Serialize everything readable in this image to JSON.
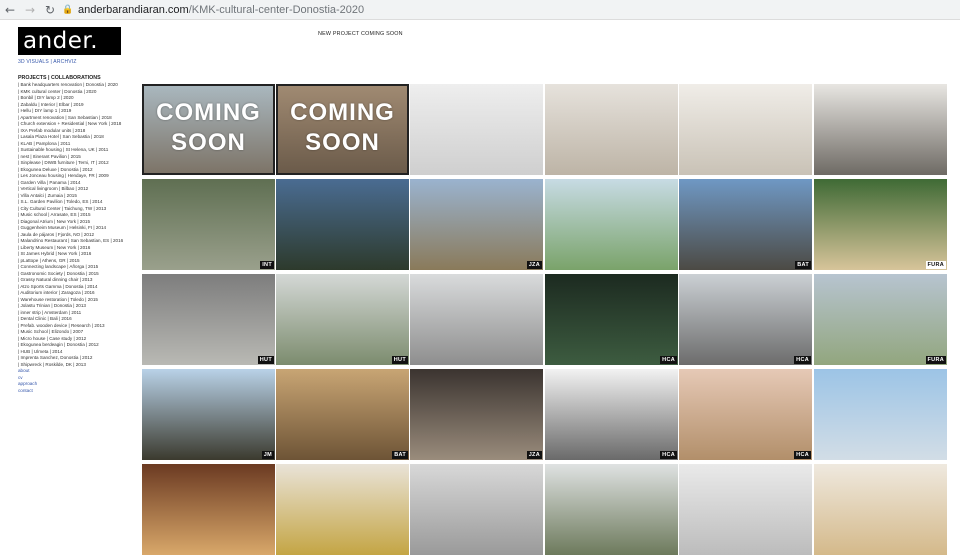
{
  "browser": {
    "back_icon": "arrow-left-icon",
    "forward_icon": "arrow-right-icon",
    "reload_icon": "reload-icon",
    "lock_icon": "lock-icon",
    "url_domain": "anderbarandiaran.com",
    "url_path": "/KMK-cultural-center-Donostia-2020"
  },
  "logo": "ander.",
  "subtitle": "3D VISUALS | ARCHVIZ",
  "notice": "NEW PROJECT COMING SOON",
  "projects_heading": "PROJECTS | COLLABORATIONS",
  "projects": [
    "| Bank headquarters renovation | Donostia | 2020",
    "| KMK cultural center | Donostia | 2020",
    "| Bonbil | DIY lamp 2 | 2020",
    "| Zabaldu | Interior | Elbar | 2019",
    "| Hellu | DIY lamp 1 | 2019",
    "| Apartment renovation | San Sebastian | 2018",
    "| Church extension + Residential | New York | 2018",
    "| IXA Prefab modular units | 2018",
    "| Lasala Plaza Hotel | San Sebastia | 2018",
    "| KLAB | Pamplona | 2011",
    "| Sustainable housing | St Helena, UK | 2011",
    "| nest | Itinerant Pavilion | 2015",
    "| Sinplease | DIWB furniture | Terni, IT | 2012",
    "| Ekogunea Deluxe | Donostia | 2012",
    "| Les Jonceau housing | Hendaye, FR | 2009",
    "| Garden Villa | Panama | 2014",
    "| Vertical livingroom | Bilbao | 2012",
    "| Villa Antalci | Zumaia | 2015",
    "| S.L. Garden Pavilion | Toledo, ES | 2014",
    "| City Cultural Center | Taichung, TW | 2013",
    "| Music school | Arrasate, ES | 2015",
    "| Diagonal Atrium | New York | 2015",
    "| Guggenheim Museum | Helsinki, FI | 2014",
    "| Jaula de pájaros | Fjords, NO | 2012",
    "| Malandrino Restaurant | San Sebastian, ES | 2016",
    "| Liberty Museum | New York | 2016",
    "| St James Hybrid | New York | 2016",
    "| pLattope | Athens, GR | 2015",
    "| Connecting landscape | Añorga | 2015",
    "| Gastronomic Society | Donostia | 2015",
    "| Grassy Natural dinning chair | 2013",
    "| Atzo Sports Gamma | Donostia | 2014",
    "| Auditorium interior | Zaragoza | 2016",
    "| Warehouse restoration | Toledo | 2015",
    "| Jolastu Trinian | Donostia | 2013",
    "| inner strip | Amsterdam | 2011",
    "| Dental Clinic | Bali | 2016",
    "| Prefab. wooden device | Research | 2013",
    "| Music School | Elizondo | 2007",
    "| Micro house | Case study | 2012",
    "| Ekogunea berdeagin | Donostia | 2012",
    "| HUB | Ulmeta | 2014",
    "| Imprenta Sanchez, Donostia | 2012",
    "| Shipwreck | Roskilde, DK | 2013"
  ],
  "links": [
    "about",
    "cv",
    "approach",
    "contact"
  ],
  "tiles": [
    {
      "label": "",
      "coming": "COMING SOON",
      "colors": [
        "#a9b7be",
        "#7d7468"
      ]
    },
    {
      "label": "",
      "coming": "COMING SOON",
      "colors": [
        "#a08a72",
        "#6b5b4a"
      ]
    },
    {
      "label": "",
      "coming": "",
      "colors": [
        "#eeeeee",
        "#cfcfcf"
      ]
    },
    {
      "label": "",
      "coming": "",
      "colors": [
        "#e6e2dc",
        "#bdb4a6"
      ]
    },
    {
      "label": "",
      "coming": "",
      "colors": [
        "#f0ede8",
        "#c9c2b6"
      ]
    },
    {
      "label": "",
      "coming": "",
      "colors": [
        "#e8e6e2",
        "#6e6a64"
      ]
    },
    {
      "label": "INT",
      "coming": "",
      "colors": [
        "#5f6f52",
        "#9aa08c"
      ]
    },
    {
      "label": "",
      "coming": "",
      "colors": [
        "#4a6c92",
        "#2d3a2c"
      ]
    },
    {
      "label": "JZA",
      "coming": "",
      "colors": [
        "#9ab3cf",
        "#8a7a5a"
      ]
    },
    {
      "label": "",
      "coming": "",
      "colors": [
        "#c7dbe4",
        "#7aa36a"
      ]
    },
    {
      "label": "BAT",
      "coming": "",
      "colors": [
        "#6f98c4",
        "#4c4a44"
      ]
    },
    {
      "label": "FURA",
      "coming": "",
      "colors": [
        "#3f6a35",
        "#d7c49a"
      ],
      "light": true
    },
    {
      "label": "HUT",
      "coming": "",
      "colors": [
        "#7d7d7d",
        "#b9b9b4"
      ]
    },
    {
      "label": "HUT",
      "coming": "",
      "colors": [
        "#d4d8d6",
        "#7c8c6e"
      ]
    },
    {
      "label": "",
      "coming": "",
      "colors": [
        "#d9dbdc",
        "#8e8e8e"
      ]
    },
    {
      "label": "HCA",
      "coming": "",
      "colors": [
        "#1c2a20",
        "#3d5c40"
      ]
    },
    {
      "label": "HCA",
      "coming": "",
      "colors": [
        "#cbd0d4",
        "#6c6c6c"
      ]
    },
    {
      "label": "FURA",
      "coming": "",
      "colors": [
        "#b7c4d0",
        "#92a67e"
      ]
    },
    {
      "label": "JM",
      "coming": "",
      "colors": [
        "#b9d2e8",
        "#3b3a2e"
      ]
    },
    {
      "label": "BAT",
      "coming": "",
      "colors": [
        "#c8a574",
        "#6e5436"
      ]
    },
    {
      "label": "JZA",
      "coming": "",
      "colors": [
        "#3b3430",
        "#9a8c7c"
      ]
    },
    {
      "label": "HCA",
      "coming": "",
      "colors": [
        "#f2f2f2",
        "#6a6a6a"
      ]
    },
    {
      "label": "HCA",
      "coming": "",
      "colors": [
        "#e6c9b6",
        "#b28f6a"
      ]
    },
    {
      "label": "",
      "coming": "",
      "colors": [
        "#9cc4e6",
        "#d2dde6"
      ]
    },
    {
      "label": "",
      "coming": "",
      "colors": [
        "#6b3a22",
        "#d9a86a"
      ]
    },
    {
      "label": "",
      "coming": "",
      "colors": [
        "#e9e3d8",
        "#c4a544"
      ]
    },
    {
      "label": "",
      "coming": "",
      "colors": [
        "#d8d8d8",
        "#9a9a9a"
      ]
    },
    {
      "label": "",
      "coming": "",
      "colors": [
        "#dfe2e2",
        "#6d7a5c"
      ]
    },
    {
      "label": "",
      "coming": "",
      "colors": [
        "#eaeaea",
        "#bcbcbc"
      ]
    },
    {
      "label": "",
      "coming": "",
      "colors": [
        "#efe9df",
        "#d4b98a"
      ]
    }
  ]
}
